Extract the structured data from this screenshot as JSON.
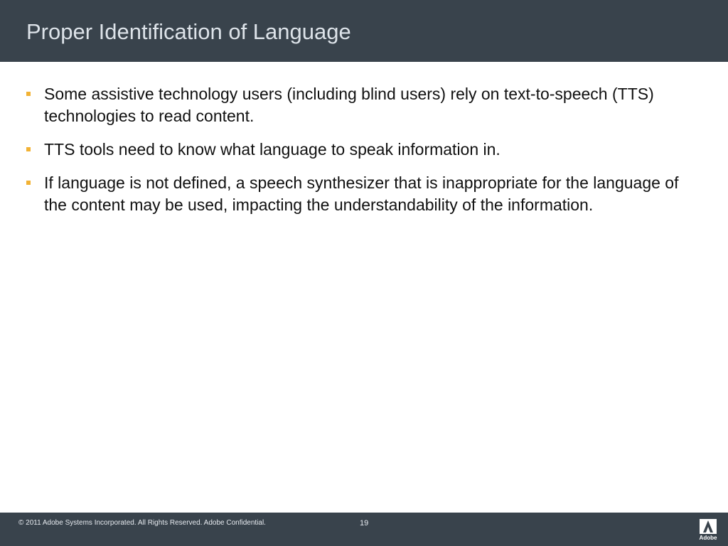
{
  "slide": {
    "title": "Proper Identification of Language",
    "bullets": [
      {
        "text": "Some assistive technology users (including blind users) rely on text-to-speech (TTS) technologies to read content."
      },
      {
        "text": "TTS tools need to know what language to speak information in."
      },
      {
        "text": "If language is not defined, a speech synthesizer that is inappropriate for the language of the content may be used, impacting the understandability of the information."
      }
    ]
  },
  "footer": {
    "copyright": "© 2011 Adobe Systems Incorporated.  All Rights Reserved.  Adobe Confidential.",
    "page_number": "19",
    "logo_text": "Adobe"
  },
  "colors": {
    "header_bg": "#39434c",
    "title_text": "#dde3e9",
    "bullet_marker": "#f2b234",
    "body_text": "#111111"
  },
  "icons": {
    "bullet": "square-bullet-icon",
    "logo": "adobe-logo-icon"
  }
}
